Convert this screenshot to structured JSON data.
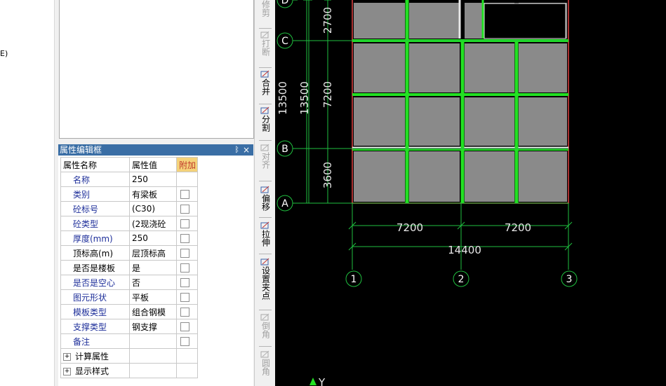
{
  "left_strip": {
    "snippet": "E)"
  },
  "property_panel": {
    "title": "属性编辑框",
    "pin_glyph": "ᛒ",
    "close_glyph": "×",
    "headers": {
      "name": "属性名称",
      "value": "属性值",
      "extra": "附加"
    },
    "rows": [
      {
        "name": "名称",
        "value": "250",
        "name_color": "blue",
        "checkbox": false
      },
      {
        "name": "类别",
        "value": "有梁板",
        "name_color": "blue",
        "checkbox": true
      },
      {
        "name": "砼标号",
        "value": "(C30)",
        "name_color": "blue",
        "checkbox": true
      },
      {
        "name": "砼类型",
        "value": "(2现浇砼",
        "name_color": "blue",
        "checkbox": true
      },
      {
        "name": "厚度(mm)",
        "value": "250",
        "name_color": "blue",
        "checkbox": true
      },
      {
        "name": "顶标高(m)",
        "value": "层顶标高",
        "name_color": "black",
        "checkbox": true
      },
      {
        "name": "是否是楼板",
        "value": "是",
        "name_color": "black",
        "checkbox": true
      },
      {
        "name": "是否是空心",
        "value": "否",
        "name_color": "blue",
        "checkbox": true
      },
      {
        "name": "图元形状",
        "value": "平板",
        "name_color": "blue",
        "checkbox": true
      },
      {
        "name": "模板类型",
        "value": "组合钢模",
        "name_color": "blue",
        "checkbox": true
      },
      {
        "name": "支撑类型",
        "value": "钢支撑",
        "name_color": "blue",
        "checkbox": true
      },
      {
        "name": "备注",
        "value": "",
        "name_color": "blue",
        "checkbox": true
      }
    ],
    "groups": [
      {
        "label": "计算属性",
        "expander": "+"
      },
      {
        "label": "显示样式",
        "expander": "+"
      }
    ]
  },
  "toolbar": {
    "items": [
      {
        "id": "trim",
        "label": "修剪",
        "disabled": true,
        "icon": "trim-icon"
      },
      {
        "id": "break",
        "label": "打断",
        "disabled": true,
        "icon": "break-icon"
      },
      {
        "id": "merge",
        "label": "合并",
        "disabled": false,
        "icon": "merge-icon"
      },
      {
        "id": "split",
        "label": "分割",
        "disabled": false,
        "icon": "split-icon"
      },
      {
        "id": "align",
        "label": "对齐",
        "disabled": true,
        "icon": "align-icon"
      },
      {
        "id": "offset",
        "label": "偏移",
        "disabled": false,
        "icon": "offset-icon"
      },
      {
        "id": "stretch",
        "label": "拉伸",
        "disabled": false,
        "icon": "stretch-icon"
      },
      {
        "id": "set-grip",
        "label": "设置夹点",
        "disabled": false,
        "icon": "set-grip-icon"
      },
      {
        "id": "chamfer",
        "label": "倒角",
        "disabled": true,
        "icon": "chamfer-icon"
      },
      {
        "id": "fillet",
        "label": "圆角",
        "disabled": true,
        "icon": "fillet-icon"
      }
    ]
  },
  "drawing": {
    "row_axes": [
      "D",
      "C",
      "B",
      "A"
    ],
    "col_axes": [
      "1",
      "2",
      "3"
    ],
    "dims_left": [
      "2700",
      "7200",
      "3600"
    ],
    "dims_total_left": [
      "13500",
      "13500"
    ],
    "dims_bottom": [
      "7200",
      "7200"
    ],
    "dim_total_bottom": "14400",
    "ucs_label": "Y",
    "colors": {
      "background": "#000000",
      "grid": "#1fbf3f",
      "slab": "#8a8a8a",
      "beam": "#22e022",
      "border": "#e04040"
    }
  }
}
